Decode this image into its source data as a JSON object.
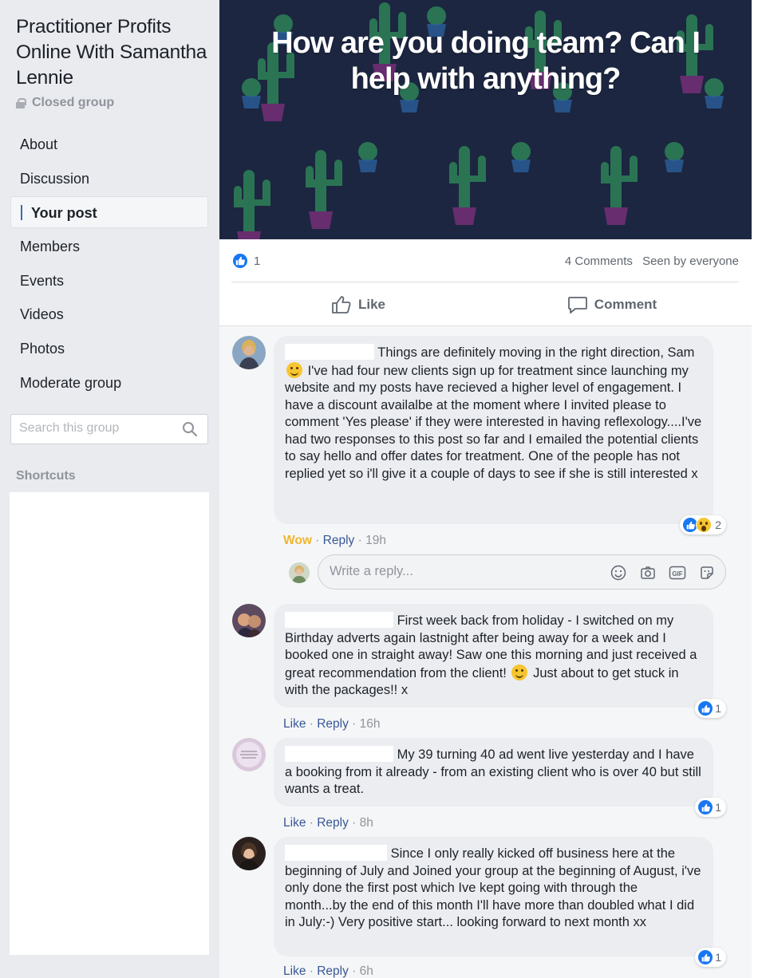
{
  "sidebar": {
    "group_title": "Practitioner Profits Online With Samantha Lennie",
    "privacy": "Closed group",
    "nav": [
      {
        "label": "About"
      },
      {
        "label": "Discussion"
      },
      {
        "label": "Your post"
      },
      {
        "label": "Members"
      },
      {
        "label": "Events"
      },
      {
        "label": "Videos"
      },
      {
        "label": "Photos"
      },
      {
        "label": "Moderate group"
      }
    ],
    "search_placeholder": "Search this group",
    "shortcuts_title": "Shortcuts"
  },
  "post": {
    "banner_text": "How are you doing team? Can I help with anything?",
    "reaction_count": "1",
    "comments_count": "4 Comments",
    "seen_by": "Seen by everyone",
    "like_label": "Like",
    "comment_label": "Comment"
  },
  "comments": [
    {
      "text_before": "Things are definitely moving in the right direction, Sam",
      "text_after": "I've had four new clients sign up for treatment since launching my website and my posts have recieved a higher level of engagement. I have a discount availalbe at the moment where I invited please to comment 'Yes please' if they were interested in having reflexology....I've had two responses to this post so far and I emailed the potential clients to say hello and offer dates for treatment. One of the people has not replied yet so i'll give it a couple of days to see if she is still interested x",
      "reaction_label": "Wow",
      "reply_label": "Reply",
      "time": "19h",
      "reaction_count": "2"
    },
    {
      "text_before": "First week back from holiday - I switched on my Birthday adverts again lastnight after being away for a week and I booked one in straight away! Saw one this morning and just received a great recommendation from the client!",
      "text_after": "Just about to get stuck in with the packages!! x",
      "reaction_label": "Like",
      "reply_label": "Reply",
      "time": "16h",
      "reaction_count": "1"
    },
    {
      "text_before": "My 39 turning 40 ad went live yesterday and I have a booking from it already - from an existing client who is over 40 but still wants a treat.",
      "reaction_label": "Like",
      "reply_label": "Reply",
      "time": "8h",
      "reaction_count": "1"
    },
    {
      "text_before": "Since I only really kicked off business here at the beginning of July and Joined your group at the beginning of August, i've only done the first post which Ive kept going with through the month...by the end of this month I'll have more than doubled what I did in July:-) Very positive start... looking forward to next month xx",
      "reaction_label": "Like",
      "reply_label": "Reply",
      "time": "6h",
      "reaction_count": "1"
    }
  ],
  "reply_box": {
    "placeholder": "Write a reply..."
  },
  "colors": {
    "facebook_blue": "#4267b2",
    "like_blue": "#1877f2",
    "wow_yellow": "#f0b52f",
    "banner_bg": "#1c2640"
  }
}
